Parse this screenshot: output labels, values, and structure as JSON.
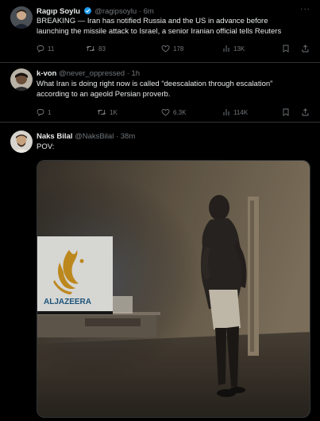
{
  "tweets": [
    {
      "name": "Ragıp Soylu",
      "verified": true,
      "handle": "@ragipsoylu",
      "time": "6m",
      "text": "BREAKING — Iran has notified Russia and the US in advance before\nlaunching the missile attack to Israel, a senior Iranian official tells Reuters",
      "replies": "11",
      "reposts": "83",
      "likes": "178",
      "views": "13K"
    },
    {
      "name": "k-von",
      "handle": "@never_oppressed",
      "time": "1h",
      "text": "What Iran is doing right now is called “deescalation through escalation”\naccording to an ageold Persian proverb.",
      "replies": "1",
      "reposts": "1K",
      "likes": "6.3K",
      "views": "114K"
    },
    {
      "name": "Naks Bilal",
      "handle": "@NaksBilal",
      "time": "38m",
      "text": "POV:",
      "media_logo_text": "ALJAZEERA"
    }
  ],
  "colors": {
    "background": "#000000",
    "text": "#e7e9ea",
    "muted": "#71767b",
    "verified": "#1d9bf0",
    "divider": "#2f3336"
  },
  "icons": [
    "reply-icon",
    "repost-icon",
    "like-icon",
    "views-icon",
    "bookmark-icon",
    "share-icon",
    "more-icon",
    "verified-badge-icon"
  ]
}
